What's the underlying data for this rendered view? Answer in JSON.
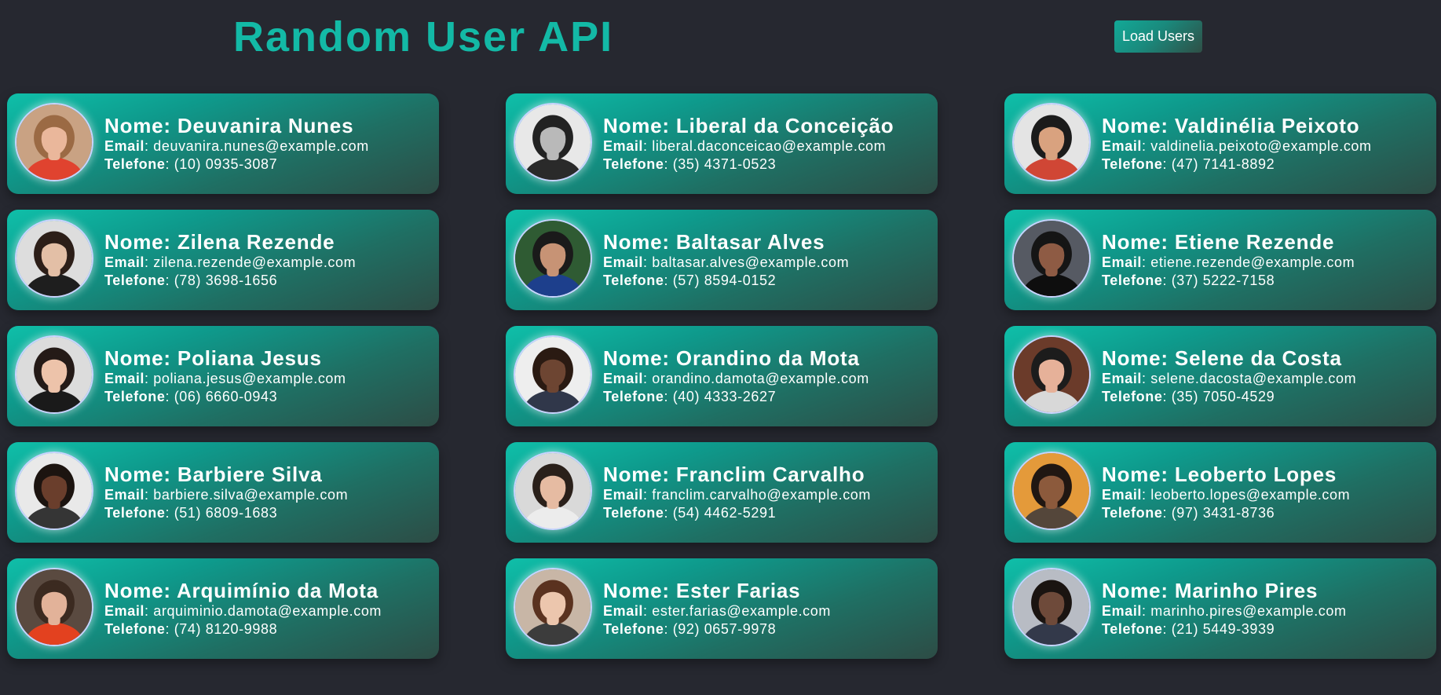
{
  "header": {
    "title": "Random User API",
    "load_button_label": "Load Users"
  },
  "labels": {
    "name_prefix": "Nome: ",
    "email_label": "Email",
    "phone_label": "Telefone",
    "separator": ": "
  },
  "colors": {
    "title_accent": "#13b9a6",
    "page_background": "#262830",
    "card_gradient_start": "#0fbfa9",
    "card_gradient_end": "#2d4c45"
  },
  "users": [
    {
      "name": "Deuvanira Nunes",
      "email": "deuvanira.nunes@example.com",
      "phone": "(10) 0935-3087",
      "avatar": {
        "bg": "#c9a283",
        "skin": "#eab79b",
        "hair": "#9b6a44",
        "shirt": "#e0432f"
      }
    },
    {
      "name": "Liberal da Conceição",
      "email": "liberal.daconceicao@example.com",
      "phone": "(35) 4371-0523",
      "avatar": {
        "bg": "#e8e8e8",
        "skin": "#b9b9b9",
        "hair": "#222222",
        "shirt": "#2a2a2a"
      }
    },
    {
      "name": "Valdinélia Peixoto",
      "email": "valdinelia.peixoto@example.com",
      "phone": "(47) 7141-8892",
      "avatar": {
        "bg": "#e4e4e4",
        "skin": "#d9a27f",
        "hair": "#1b1b1b",
        "shirt": "#d04635"
      }
    },
    {
      "name": "Zilena Rezende",
      "email": "zilena.rezende@example.com",
      "phone": "(78) 3698-1656",
      "avatar": {
        "bg": "#dddddd",
        "skin": "#e3bfa6",
        "hair": "#2c1e18",
        "shirt": "#1e1e1e"
      }
    },
    {
      "name": "Baltasar Alves",
      "email": "baltasar.alves@example.com",
      "phone": "(57) 8594-0152",
      "avatar": {
        "bg": "#2f5b33",
        "skin": "#c79375",
        "hair": "#1a1a1a",
        "shirt": "#1d3f8c"
      }
    },
    {
      "name": "Etiene Rezende",
      "email": "etiene.rezende@example.com",
      "phone": "(37) 5222-7158",
      "avatar": {
        "bg": "#565a63",
        "skin": "#8e5b44",
        "hair": "#151515",
        "shirt": "#0e0e0e"
      }
    },
    {
      "name": "Poliana Jesus",
      "email": "poliana.jesus@example.com",
      "phone": "(06) 6660-0943",
      "avatar": {
        "bg": "#dcdcdc",
        "skin": "#edc3aa",
        "hair": "#241a17",
        "shirt": "#1a1a1a"
      }
    },
    {
      "name": "Orandino da Mota",
      "email": "orandino.damota@example.com",
      "phone": "(40) 4333-2627",
      "avatar": {
        "bg": "#eeeeee",
        "skin": "#6d4532",
        "hair": "#2a1a12",
        "shirt": "#30374a"
      }
    },
    {
      "name": "Selene da Costa",
      "email": "selene.dacosta@example.com",
      "phone": "(35) 7050-4529",
      "avatar": {
        "bg": "#6b3b2a",
        "skin": "#e6b199",
        "hair": "#1c1c1c",
        "shirt": "#d8d8d8"
      }
    },
    {
      "name": "Barbiere Silva",
      "email": "barbiere.silva@example.com",
      "phone": "(51) 6809-1683",
      "avatar": {
        "bg": "#e9e9e9",
        "skin": "#6a3e2c",
        "hair": "#1c1410",
        "shirt": "#353535"
      }
    },
    {
      "name": "Franclim Carvalho",
      "email": "franclim.carvalho@example.com",
      "phone": "(54) 4462-5291",
      "avatar": {
        "bg": "#d9d9d9",
        "skin": "#e6bba2",
        "hair": "#2a201a",
        "shirt": "#ececec"
      }
    },
    {
      "name": "Leoberto Lopes",
      "email": "leoberto.lopes@example.com",
      "phone": "(97) 3431-8736",
      "avatar": {
        "bg": "#e49a3a",
        "skin": "#8c5a3c",
        "hair": "#201712",
        "shirt": "#54463a"
      }
    },
    {
      "name": "Arquimínio da Mota",
      "email": "arquiminio.damota@example.com",
      "phone": "(74) 8120-9988",
      "avatar": {
        "bg": "#5a4a40",
        "skin": "#e2b299",
        "hair": "#3b2a20",
        "shirt": "#e3411f"
      }
    },
    {
      "name": "Ester Farias",
      "email": "ester.farias@example.com",
      "phone": "(92) 0657-9978",
      "avatar": {
        "bg": "#c8b6a6",
        "skin": "#ecc6ad",
        "hair": "#5a321f",
        "shirt": "#3c3c3c"
      }
    },
    {
      "name": "Marinho Pires",
      "email": "marinho.pires@example.com",
      "phone": "(21) 5449-3939",
      "avatar": {
        "bg": "#b8bcc4",
        "skin": "#6e4a3a",
        "hair": "#1a1411",
        "shirt": "#33394a"
      }
    }
  ]
}
